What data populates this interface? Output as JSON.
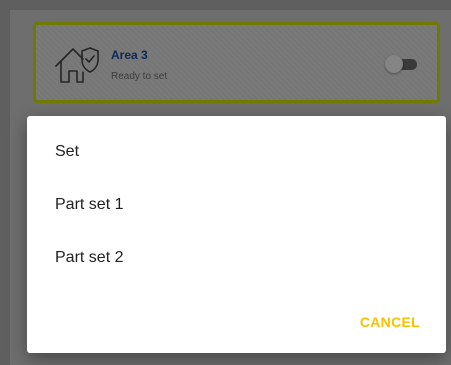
{
  "area_card": {
    "name": "Area 3",
    "status": "Ready to set",
    "icon": "house-shield-icon",
    "toggle_on": false
  },
  "dialog": {
    "options": [
      {
        "label": "Set"
      },
      {
        "label": "Part set 1"
      },
      {
        "label": "Part set 2"
      }
    ],
    "cancel_label": "CANCEL"
  },
  "colors": {
    "accent": "#f2c400",
    "card_border": "#6f7a00",
    "area_name": "#0b2a59",
    "scrim": "#6e6e6e"
  }
}
